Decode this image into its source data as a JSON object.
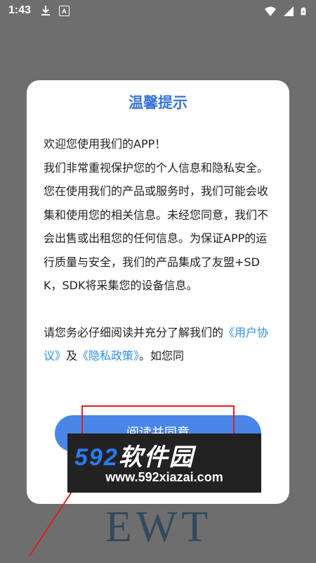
{
  "status_bar": {
    "time": "1:43",
    "icons_left": [
      "download-icon",
      "a-icon"
    ],
    "a_letter": "A",
    "icons_right": [
      "wifi-icon",
      "signal-icon",
      "battery-icon"
    ]
  },
  "dialog": {
    "title": "温馨提示",
    "welcome": "欢迎您使用我们的APP！",
    "body": "我们非常重视保护您的个人信息和隐私安全。您在使用我们的产品或服务时，我们可能会收集和使用您的相关信息。未经您同意，我们不会出售或出租您的任何信息。为保证APP的运行质量与安全，我们的产品集成了友盟+SDK，SDK将采集您的设备信息。",
    "notice_prefix": "请您务必仔细阅读并充分了解我们的",
    "user_agreement_link": "《用户协议》",
    "conj": "及",
    "privacy_policy_link": "《隐私政策》",
    "notice_suffix": "。如您同",
    "agree_button": "阅读并同意"
  },
  "watermark": {
    "number": "592",
    "name": "软件园",
    "url": "www.592xiazai.com"
  },
  "background_logo": "EWT",
  "colors": {
    "title": "#3a76d8",
    "link": "#2f8fe8",
    "button": "#4a86e8",
    "annotation": "#e02020",
    "overlay": "#6e6e6e"
  }
}
